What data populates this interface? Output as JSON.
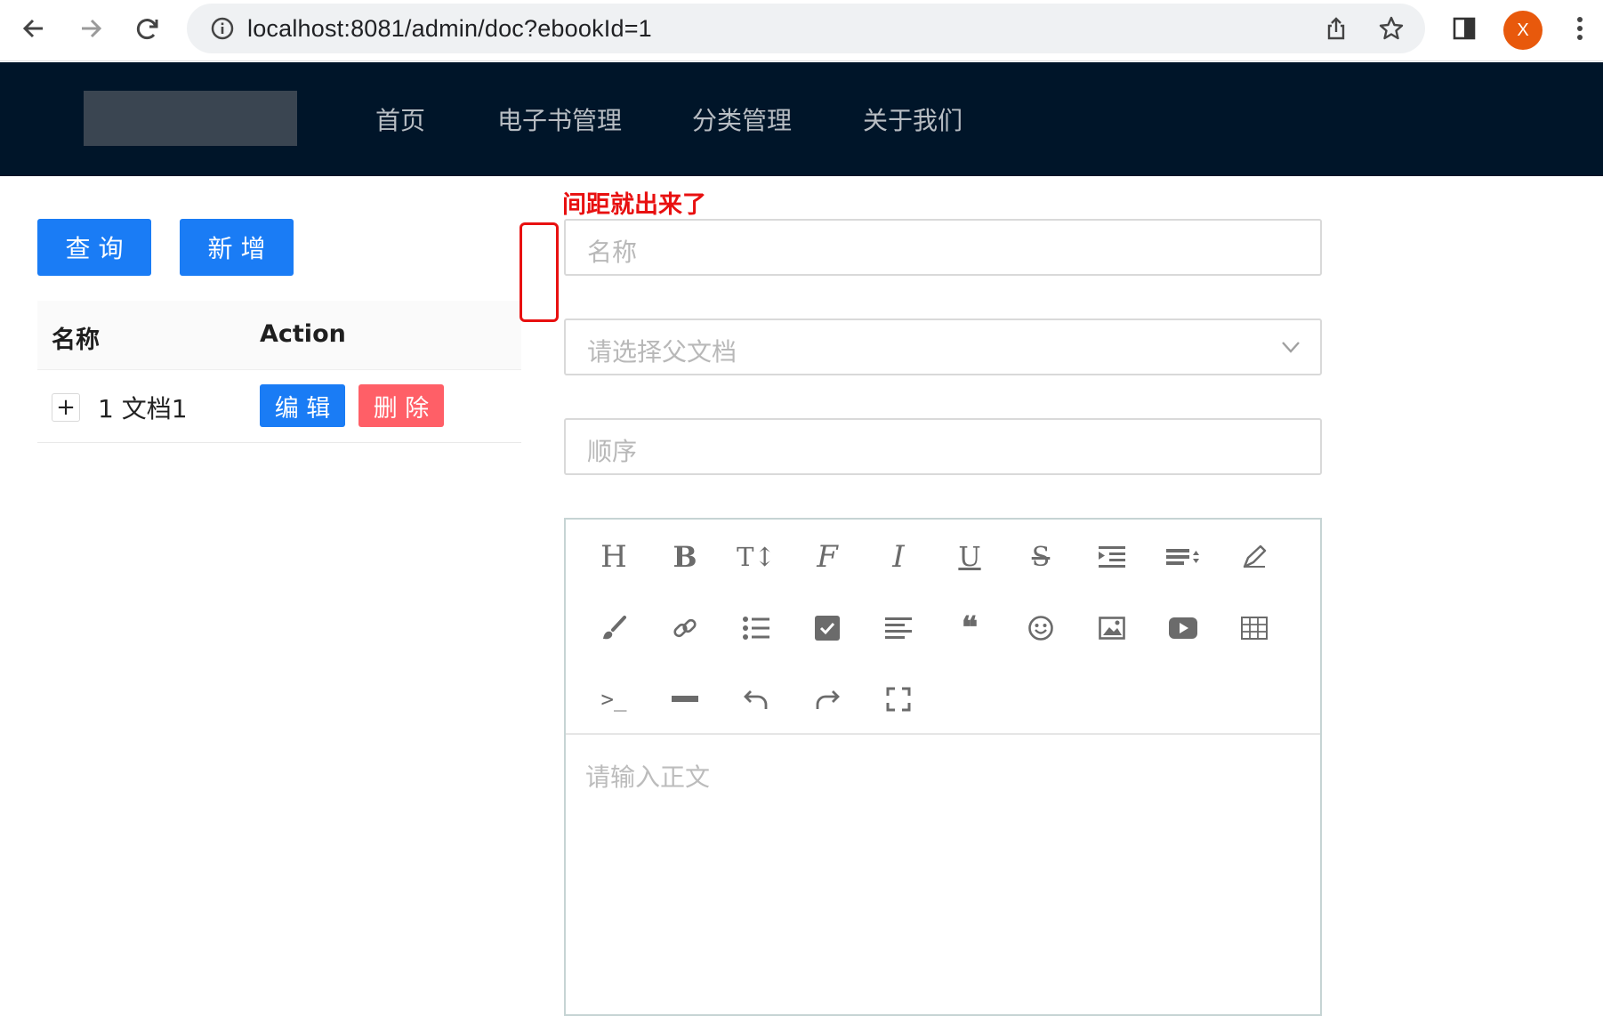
{
  "browser": {
    "url": "localhost:8081/admin/doc?ebookId=1",
    "profile_initial": "X"
  },
  "header": {
    "menu": [
      {
        "label": "首页"
      },
      {
        "label": "电子书管理"
      },
      {
        "label": "分类管理"
      },
      {
        "label": "关于我们"
      }
    ]
  },
  "toolbar": {
    "query_label": "查 询",
    "add_label": "新 增"
  },
  "table": {
    "columns": [
      "名称",
      "Action"
    ],
    "rows": [
      {
        "expand_icon": "+",
        "name": "1 文档1",
        "edit_label": "编 辑",
        "delete_label": "删 除"
      }
    ]
  },
  "annotation": {
    "text": "间距就出来了"
  },
  "form": {
    "name_placeholder": "名称",
    "parent_placeholder": "请选择父文档",
    "sort_placeholder": "顺序",
    "content_placeholder": "请输入正文"
  },
  "editor_toolbar": {
    "icons": [
      "heading-icon",
      "bold-icon",
      "font-size-icon",
      "font-family-icon",
      "italic-icon",
      "underline-icon",
      "strikethrough-icon",
      "indent-icon",
      "line-height-icon",
      "pen-icon",
      "paint-brush-icon",
      "link-icon",
      "bullet-list-icon",
      "checkbox-icon",
      "align-icon",
      "quote-icon",
      "emoji-icon",
      "image-icon",
      "video-icon",
      "table-icon",
      "code-icon",
      "divider-icon",
      "undo-icon",
      "redo-icon",
      "fullscreen-icon"
    ],
    "glyphs": {
      "heading": "H",
      "bold": "B",
      "font_size": "T↕",
      "font_family": "F",
      "italic": "I",
      "underline": "U",
      "strike": "S",
      "quote": "❝",
      "code": ">_"
    }
  },
  "colors": {
    "header_bg": "#001529",
    "primary": "#1a7cf5",
    "danger": "#ff5f67",
    "annotation": "#e81010"
  }
}
